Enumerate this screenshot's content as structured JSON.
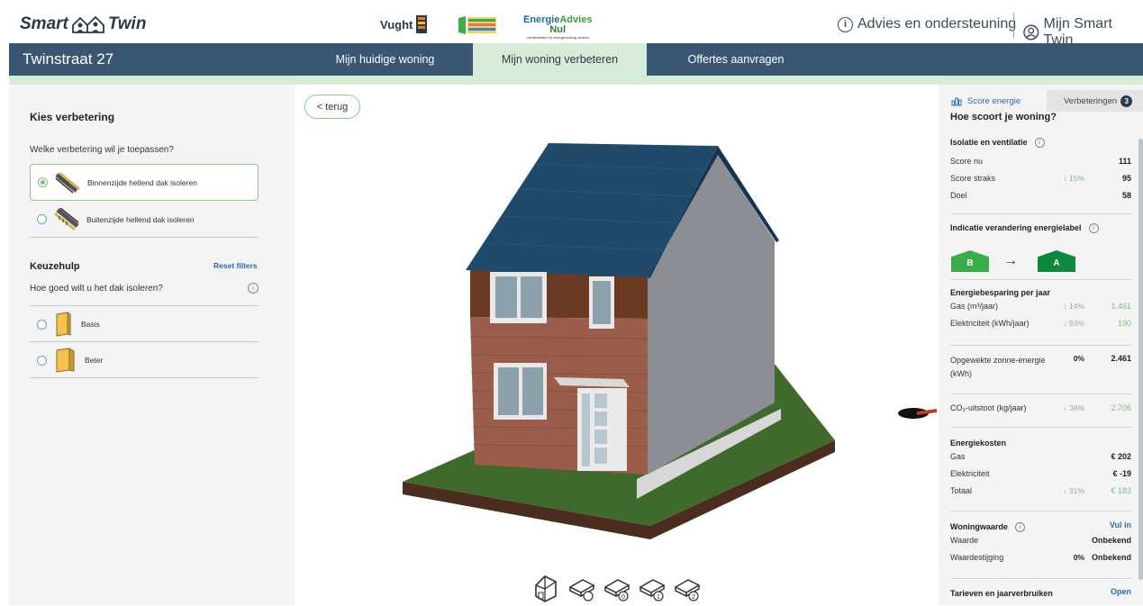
{
  "header": {
    "brand_left": "Smart",
    "brand_right": "Twin",
    "partner_vught": "Vught",
    "energie_name_a": "Energie",
    "energie_name_b": "Advies",
    "energie_sub": "Nul",
    "energie_tagline": "comfortabel en energiezuinig wonen",
    "advies_link": "Advies en ondersteuning",
    "account_link": "Mijn Smart Twin"
  },
  "nav": {
    "address": "Twinstraat 27",
    "tabs": [
      "Mijn huidige woning",
      "Mijn woning verbeteren",
      "Offertes aanvragen"
    ],
    "active_tab": "Mijn woning verbeteren"
  },
  "left": {
    "title": "Kies verbetering",
    "question": "Welke verbetering wil je toepassen?",
    "options": [
      {
        "label": "Binnenzijde hellend dak isoleren",
        "selected": true
      },
      {
        "label": "Buitenzijde hellend dak isoleren",
        "selected": false
      }
    ],
    "keuzehulp_title": "Keuzehulp",
    "reset_label": "Reset filters",
    "question2": "Hoe goed wilt u het dak isoleren?",
    "materials": [
      {
        "label": "Basis"
      },
      {
        "label": "Beter"
      }
    ]
  },
  "viewer": {
    "back_label": "< terug",
    "view_icons": [
      "house-view-icon",
      "floor-view-icon",
      "floor-0-icon",
      "floor-1-icon",
      "floor-2-icon"
    ]
  },
  "right": {
    "tab_score": "Score energie",
    "tab_verbeteringen": "Verbeteringen",
    "verbeteringen_count": "3",
    "heading": "Hoe scoort je woning?",
    "isolatie": {
      "title": "Isolatie en ventilatie",
      "rows": [
        {
          "label": "Score nu",
          "pct": "",
          "value": "111"
        },
        {
          "label": "Score straks",
          "pct": "↓ 15%",
          "value": "95"
        },
        {
          "label": "Doel",
          "pct": "",
          "value": "58"
        }
      ]
    },
    "label_title": "Indicatie verandering energielabel",
    "label_from": "B",
    "label_to": "A",
    "besparing": {
      "title": "Energiebesparing per jaar",
      "rows": [
        {
          "label": "Gas (m³/jaar)",
          "pct": "↓ 14%",
          "value": "1.461"
        },
        {
          "label": "Elektriciteit (kWh/jaar)",
          "pct": "↓ 93%",
          "value": "190"
        }
      ]
    },
    "zonne": {
      "label": "Opgewekte zonne-energie (kWh)",
      "pct": "0%",
      "value": "2.461"
    },
    "co2": {
      "label": "CO₂-uitstoot (kg/jaar)",
      "pct": "↓ 38%",
      "value": "2.706"
    },
    "kosten": {
      "title": "Energiekosten",
      "rows": [
        {
          "label": "Gas",
          "pct": "",
          "value": "€ 202"
        },
        {
          "label": "Elektriciteit",
          "pct": "",
          "value": "€ -19"
        },
        {
          "label": "Totaal",
          "pct": "↓ 31%",
          "value": "€ 183"
        }
      ]
    },
    "woningwaarde": {
      "title": "Woningwaarde",
      "action": "Vul in",
      "rows": [
        {
          "label": "Waarde",
          "pct": "",
          "value": "Onbekend"
        },
        {
          "label": "Waardestijging",
          "pct": "0%",
          "value": "Onbekend"
        }
      ]
    },
    "tarieven": {
      "title": "Tarieven en jaarverbruiken",
      "action": "Open"
    }
  },
  "colors": {
    "navbar": "#3b5673",
    "active_tab": "#d7ecd8",
    "accent_green": "#7cc07f",
    "link_blue": "#2a6bb0",
    "label_a": "#0b8a3e",
    "label_b": "#3aac49"
  }
}
